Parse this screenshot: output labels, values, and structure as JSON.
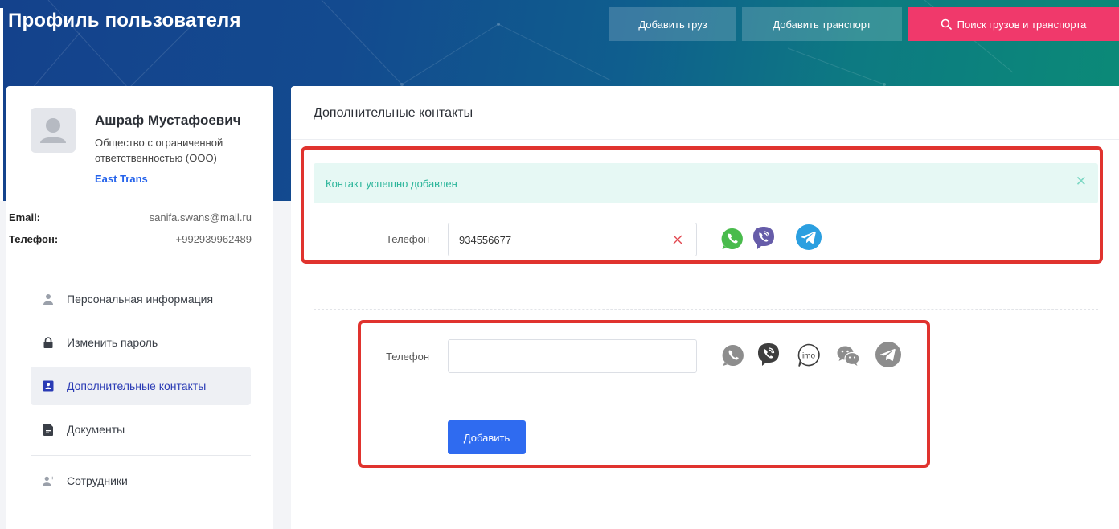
{
  "header": {
    "title": "Профиль пользователя",
    "buttons": {
      "add_cargo": "Добавить груз",
      "add_transport": "Добавить транспорт",
      "search": "Поиск грузов и транспорта"
    },
    "colors": {
      "search_button": "#f0396b"
    }
  },
  "profile": {
    "name": "Ашраф Мустафоевич",
    "company_type": "Общество с ограниченной ответственностью (ООО)",
    "company_name": "East Trans",
    "email_label": "Email:",
    "email": "sanifa.swans@mail.ru",
    "phone_label": "Телефон:",
    "phone": "+992939962489"
  },
  "nav": {
    "items": [
      {
        "label": "Персональная информация",
        "icon": "user-icon"
      },
      {
        "label": "Изменить пароль",
        "icon": "lock-icon"
      },
      {
        "label": "Дополнительные контакты",
        "icon": "contact-card-icon",
        "active": true
      },
      {
        "label": "Документы",
        "icon": "document-icon"
      },
      {
        "label": "Сотрудники",
        "icon": "add-user-icon"
      }
    ]
  },
  "main": {
    "title": "Дополнительные контакты",
    "alert": "Контакт успешно добавлен",
    "existing_contact": {
      "label": "Телефон",
      "value": "934556677",
      "messengers": [
        "whatsapp-icon",
        "viber-icon",
        "telegram-icon"
      ]
    },
    "new_contact": {
      "label": "Телефон",
      "value": "",
      "messengers": [
        "whatsapp-icon",
        "viber-icon",
        "imo-icon",
        "wechat-icon",
        "telegram-icon"
      ],
      "imo_text": "imo",
      "submit": "Добавить"
    }
  }
}
